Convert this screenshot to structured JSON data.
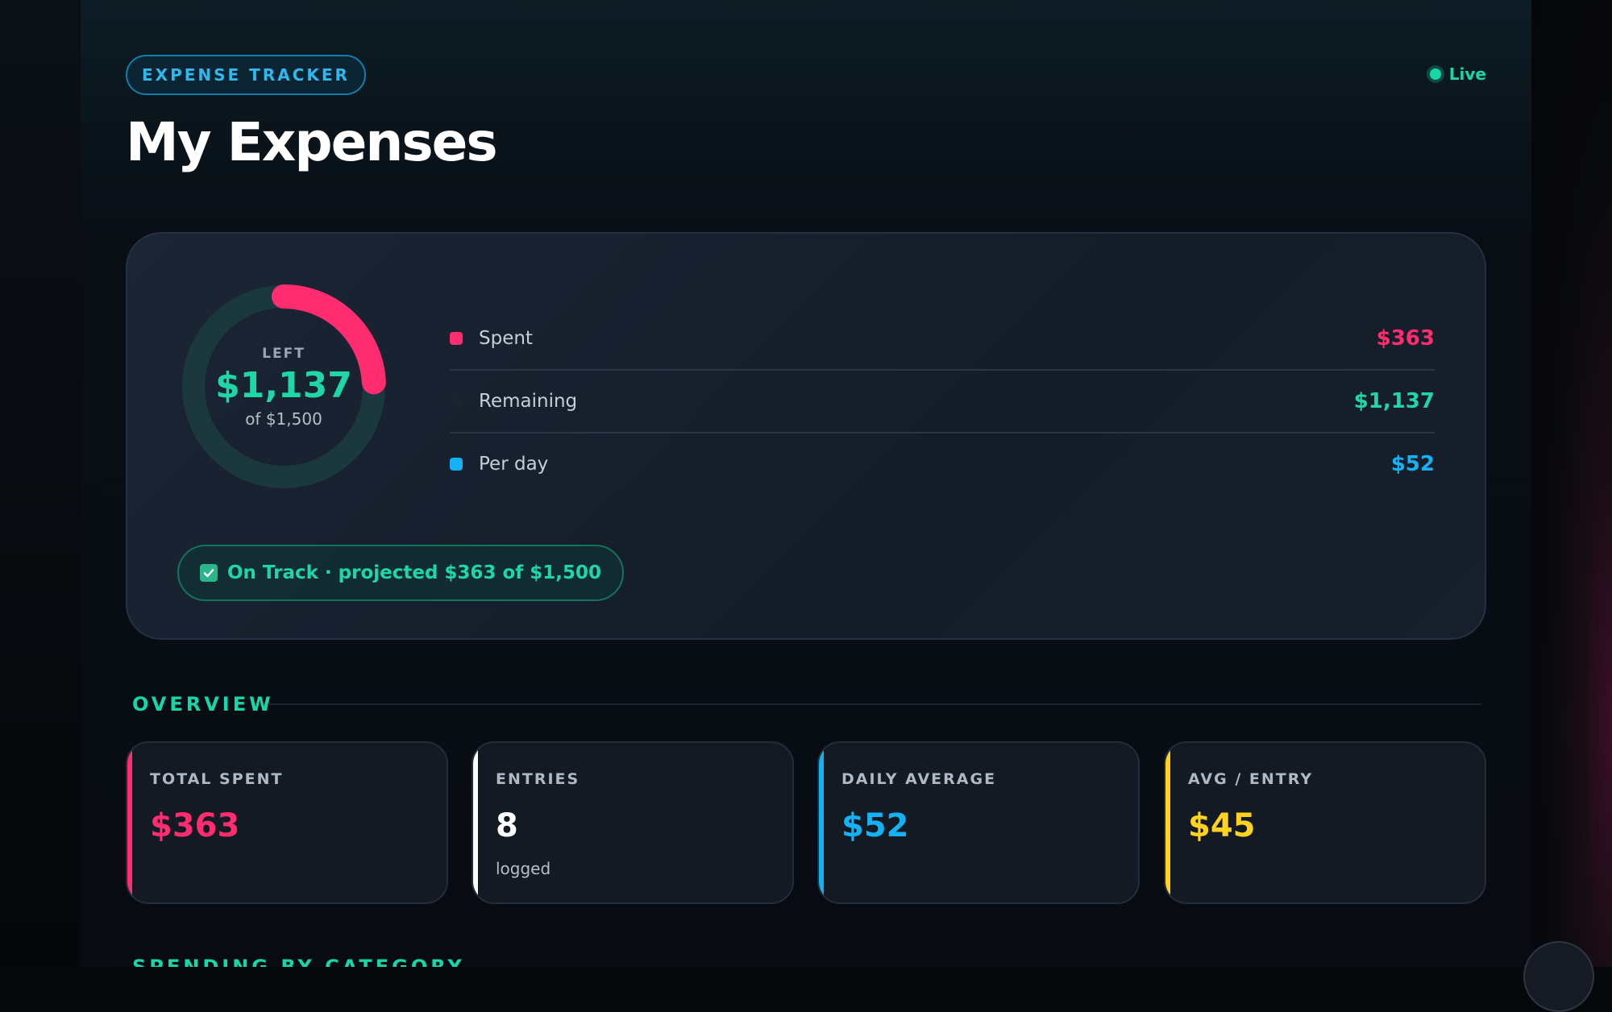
{
  "header": {
    "chip_label": "EXPENSE TRACKER",
    "live_label": "Live",
    "title": "My Expenses"
  },
  "budget": {
    "total": 1500,
    "spent": 363,
    "ring_label": "LEFT",
    "ring_value": "$1,137",
    "ring_sub": "of $1,500",
    "spent_color": "#ff2d6f",
    "remaining_color": "#1fd6a8",
    "track_color": "#1a2330",
    "stats": [
      {
        "label": "Spent",
        "value": "$363",
        "dot_color": "#ff2d6f",
        "value_color": "#ff2d6f"
      },
      {
        "label": "Remaining",
        "value": "$1,137",
        "dot_color": "#1a2330",
        "value_color": "#1fd6a8"
      },
      {
        "label": "Per day",
        "value": "$52",
        "dot_color": "#14b2f5",
        "value_color": "#14b2f5"
      }
    ],
    "status_icon": "check-icon",
    "status_text": "On Track · projected $363 of $1,500"
  },
  "overview": {
    "title": "OVERVIEW",
    "cards": [
      {
        "label": "TOTAL SPENT",
        "value": "$363",
        "sub": "",
        "accent": "#ff2d6f",
        "value_color": "#ff2d6f"
      },
      {
        "label": "ENTRIES",
        "value": "8",
        "sub": "logged",
        "accent": "#ffffff",
        "value_color": "#ffffff"
      },
      {
        "label": "DAILY AVERAGE",
        "value": "$52",
        "sub": "",
        "accent": "#14b2f5",
        "value_color": "#14b2f5"
      },
      {
        "label": "AVG / ENTRY",
        "value": "$45",
        "sub": "",
        "accent": "#ffd21f",
        "value_color": "#ffd21f"
      }
    ]
  },
  "next_section": {
    "title": "SPENDING BY CATEGORY"
  }
}
